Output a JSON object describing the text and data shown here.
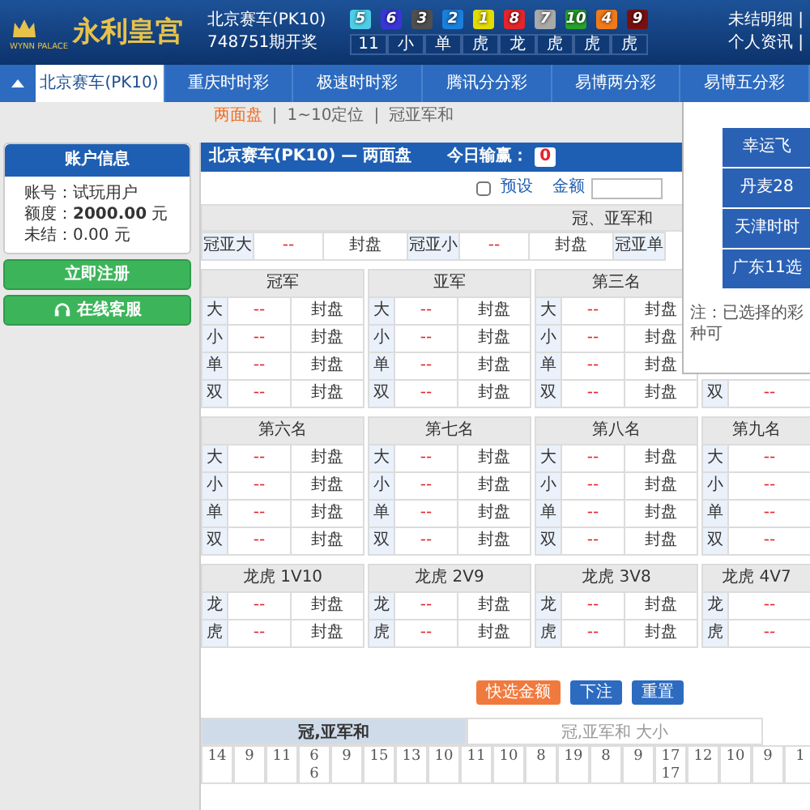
{
  "header": {
    "logo": {
      "text": "永利皇宫",
      "subtext": "WYNN PALACE"
    },
    "draw": {
      "game": "北京赛车(PK10)",
      "period": "748751期开奖"
    },
    "balls": [
      {
        "number": "5",
        "color": "#4fcde6"
      },
      {
        "number": "6",
        "color": "#3a35d8"
      },
      {
        "number": "3",
        "color": "#4f4f4f"
      },
      {
        "number": "2",
        "color": "#1b7fdb"
      },
      {
        "number": "1",
        "color": "#e4dc00"
      },
      {
        "number": "8",
        "color": "#e3242b"
      },
      {
        "number": "7",
        "color": "#a9a9a9"
      },
      {
        "number": "10",
        "color": "#27a22a"
      },
      {
        "number": "4",
        "color": "#f07a1a"
      },
      {
        "number": "9",
        "color": "#781010"
      }
    ],
    "ball_labels": [
      "11",
      "小",
      "单",
      "虎",
      "龙",
      "虎",
      "虎",
      "虎"
    ],
    "links": [
      {
        "label": "未结明细",
        "separator": "|"
      },
      {
        "label": "个人资讯",
        "separator": "|"
      }
    ]
  },
  "nav": {
    "tabs": [
      {
        "label": "北京赛车(PK10)",
        "selected": true
      },
      {
        "label": "重庆时时彩",
        "selected": false
      },
      {
        "label": "极速时时彩",
        "selected": false
      },
      {
        "label": "腾讯分分彩",
        "selected": false
      },
      {
        "label": "易博两分彩",
        "selected": false
      },
      {
        "label": "易博五分彩",
        "selected": false
      }
    ]
  },
  "subnav": {
    "separator": "|",
    "items": [
      {
        "label": "两面盘",
        "selected": true
      },
      {
        "label": "1~10定位",
        "selected": false
      },
      {
        "label": "冠亚军和",
        "selected": false
      }
    ]
  },
  "account": {
    "title": "账户信息",
    "lines": [
      "账号：试玩用户",
      "额度：**2000.00** 元",
      "未结：0.00 元"
    ]
  },
  "side_buttons": [
    {
      "label": "立即注册",
      "kind": "plain"
    },
    {
      "label": "在线客服",
      "kind": "support"
    }
  ],
  "panel": {
    "title": "北京赛车(PK10) — 两面盘",
    "profit_label": "今日输赢：",
    "profit": "0",
    "preset": {
      "label": "预设",
      "checked": false
    },
    "amount": {
      "label": "金额"
    },
    "sum_section": {
      "title": "冠、亚军和",
      "cells": [
        {
          "label": "冠亚大",
          "odds": "--",
          "status": "封盘"
        },
        {
          "label": "冠亚小",
          "odds": "--",
          "status": "封盘"
        },
        {
          "label": "冠亚单"
        }
      ]
    },
    "groups": [
      {
        "tables": [
          {
            "title": "冠军",
            "rows": [
              {
                "label": "大",
                "odds": "--",
                "status": "封盘"
              },
              {
                "label": "小",
                "odds": "--",
                "status": "封盘"
              },
              {
                "label": "单",
                "odds": "--",
                "status": "封盘"
              },
              {
                "label": "双",
                "odds": "--",
                "status": "封盘"
              }
            ]
          },
          {
            "title": "亚军",
            "rows": [
              {
                "label": "大",
                "odds": "--",
                "status": "封盘"
              },
              {
                "label": "小",
                "odds": "--",
                "status": "封盘"
              },
              {
                "label": "单",
                "odds": "--",
                "status": "封盘"
              },
              {
                "label": "双",
                "odds": "--",
                "status": "封盘"
              }
            ]
          },
          {
            "title": "第三名",
            "rows": [
              {
                "label": "大",
                "odds": "--",
                "status": "封盘"
              },
              {
                "label": "小",
                "odds": "--",
                "status": "封盘"
              },
              {
                "label": "单",
                "odds": "--",
                "status": "封盘"
              },
              {
                "label": "双",
                "odds": "--",
                "status": "封盘"
              }
            ]
          },
          {
            "rows": [
              {
                "label": "双",
                "odds": "--"
              }
            ]
          }
        ]
      },
      {
        "tables": [
          {
            "title": "第六名",
            "rows": [
              {
                "label": "大",
                "odds": "--",
                "status": "封盘"
              },
              {
                "label": "小",
                "odds": "--",
                "status": "封盘"
              },
              {
                "label": "单",
                "odds": "--",
                "status": "封盘"
              },
              {
                "label": "双",
                "odds": "--",
                "status": "封盘"
              }
            ]
          },
          {
            "title": "第七名",
            "rows": [
              {
                "label": "大",
                "odds": "--",
                "status": "封盘"
              },
              {
                "label": "小",
                "odds": "--",
                "status": "封盘"
              },
              {
                "label": "单",
                "odds": "--",
                "status": "封盘"
              },
              {
                "label": "双",
                "odds": "--",
                "status": "封盘"
              }
            ]
          },
          {
            "title": "第八名",
            "rows": [
              {
                "label": "大",
                "odds": "--",
                "status": "封盘"
              },
              {
                "label": "小",
                "odds": "--",
                "status": "封盘"
              },
              {
                "label": "单",
                "odds": "--",
                "status": "封盘"
              },
              {
                "label": "双",
                "odds": "--",
                "status": "封盘"
              }
            ]
          },
          {
            "title": "第九名",
            "rows": [
              {
                "label": "大",
                "odds": "--"
              },
              {
                "label": "小",
                "odds": "--"
              },
              {
                "label": "单",
                "odds": "--"
              },
              {
                "label": "双",
                "odds": "--"
              }
            ]
          }
        ]
      },
      {
        "tables": [
          {
            "title": "龙虎 1V10",
            "rows": [
              {
                "label": "龙",
                "odds": "--",
                "status": "封盘"
              },
              {
                "label": "虎",
                "odds": "--",
                "status": "封盘"
              }
            ]
          },
          {
            "title": "龙虎 2V9",
            "rows": [
              {
                "label": "龙",
                "odds": "--",
                "status": "封盘"
              },
              {
                "label": "虎",
                "odds": "--",
                "status": "封盘"
              }
            ]
          },
          {
            "title": "龙虎 3V8",
            "rows": [
              {
                "label": "龙",
                "odds": "--",
                "status": "封盘"
              },
              {
                "label": "虎",
                "odds": "--",
                "status": "封盘"
              }
            ]
          },
          {
            "title": "龙虎 4V7",
            "rows": [
              {
                "label": "龙",
                "odds": "--"
              },
              {
                "label": "虎",
                "odds": "--"
              }
            ]
          }
        ]
      }
    ],
    "actions": [
      {
        "label": "快选金额",
        "kind": "quick"
      },
      {
        "label": "下注",
        "kind": "submit"
      },
      {
        "label": "重置",
        "kind": "reset"
      }
    ],
    "history": {
      "tabs": [
        {
          "label": "冠,亚军和",
          "selected": true
        },
        {
          "label": "冠,亚军和 大小",
          "selected": false
        }
      ],
      "cells": [
        [
          "14"
        ],
        [
          "9"
        ],
        [
          "11"
        ],
        [
          "6",
          "6"
        ],
        [
          "9"
        ],
        [
          "15"
        ],
        [
          "13"
        ],
        [
          "10"
        ],
        [
          "11"
        ],
        [
          "10"
        ],
        [
          "8"
        ],
        [
          "19"
        ],
        [
          "8"
        ],
        [
          "9"
        ],
        [
          "17",
          "17"
        ],
        [
          "12"
        ],
        [
          "10"
        ],
        [
          "9"
        ],
        [
          "1"
        ]
      ]
    }
  },
  "popup": {
    "buttons": [
      "幸运飞",
      "丹麦28",
      "天津时时",
      "广东11选"
    ],
    "note": "注：已选择的彩种可"
  }
}
